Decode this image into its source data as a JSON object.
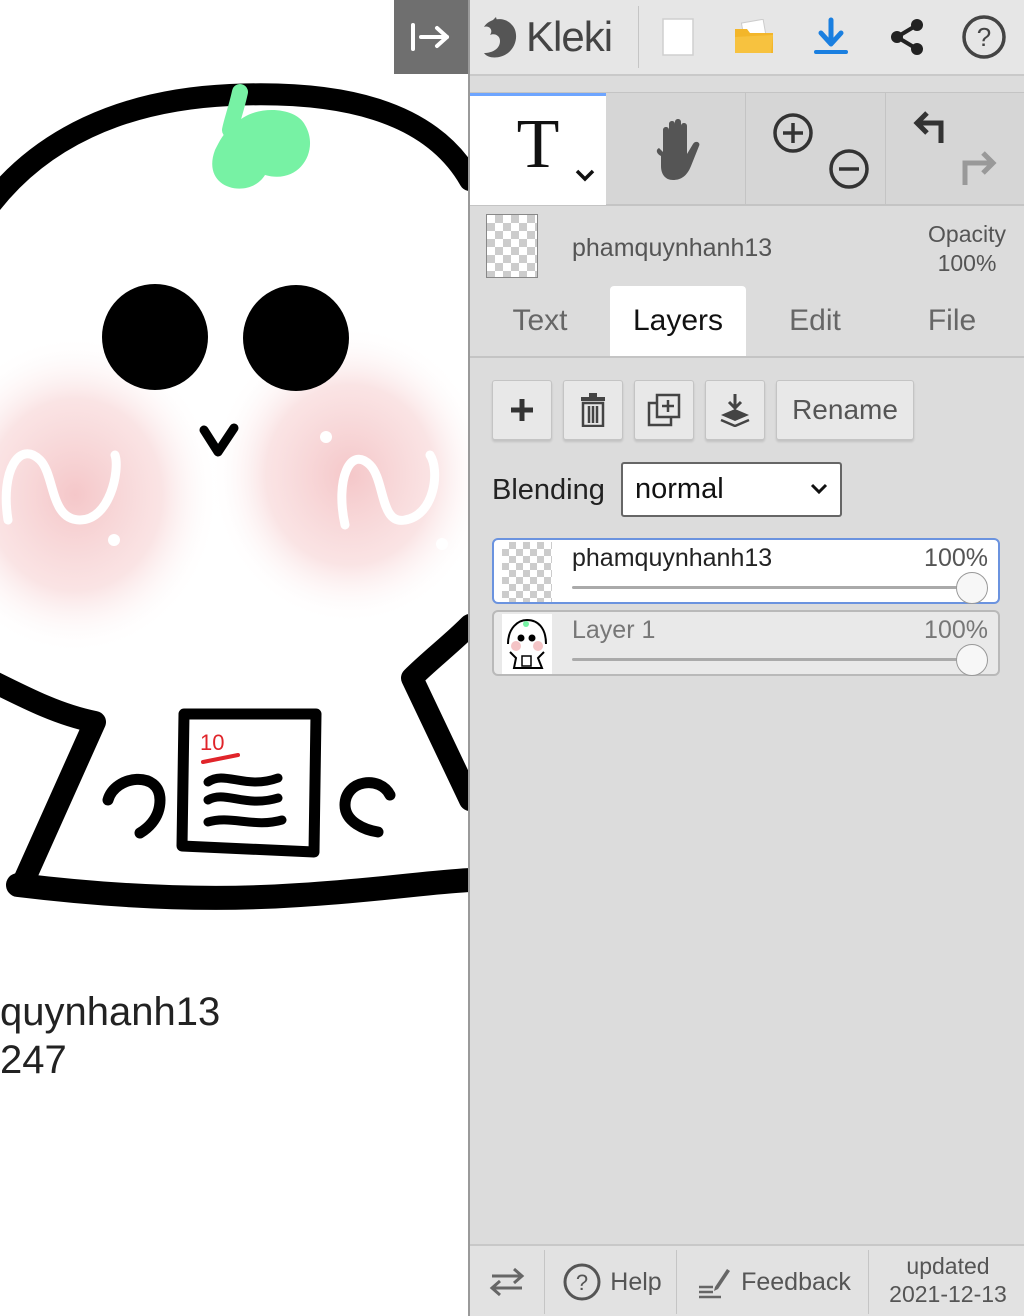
{
  "app": {
    "name": "Kleki"
  },
  "canvas": {
    "text_line_1": "quynhanh13",
    "text_line_2": "247",
    "drawing_label": "10"
  },
  "toolbar": {
    "icons": [
      "collapse-sidebar-icon",
      "kleki-logo-icon",
      "new-document-icon",
      "open-folder-icon",
      "download-icon",
      "share-icon",
      "help-circle-icon"
    ]
  },
  "tools": {
    "text_tool_glyph": "T",
    "selected_tool": "text"
  },
  "active_layer": {
    "name": "phamquynhanh13",
    "opacity_label": "Opacity",
    "opacity_value": "100%"
  },
  "tabs": [
    {
      "label": "Text",
      "active": false
    },
    {
      "label": "Layers",
      "active": true
    },
    {
      "label": "Edit",
      "active": false
    },
    {
      "label": "File",
      "active": false
    }
  ],
  "layer_actions": {
    "rename_label": "Rename"
  },
  "blending": {
    "label": "Blending",
    "value": "normal"
  },
  "layers": [
    {
      "name": "phamquynhanh13",
      "opacity_text": "100%",
      "opacity": 1.0,
      "active": true
    },
    {
      "name": "Layer 1",
      "opacity_text": "100%",
      "opacity": 1.0,
      "active": false
    }
  ],
  "footer": {
    "help_label": "Help",
    "feedback_label": "Feedback",
    "updated_label": "updated",
    "updated_date": "2021-12-13"
  },
  "colors": {
    "accent": "#6ea5ff",
    "download_blue": "#1a7fe0",
    "folder_yellow": "#f3b62a",
    "sprout_green": "#77f2a4",
    "blush_pink": "#f4c4c6",
    "mark_red": "#e0242a"
  }
}
